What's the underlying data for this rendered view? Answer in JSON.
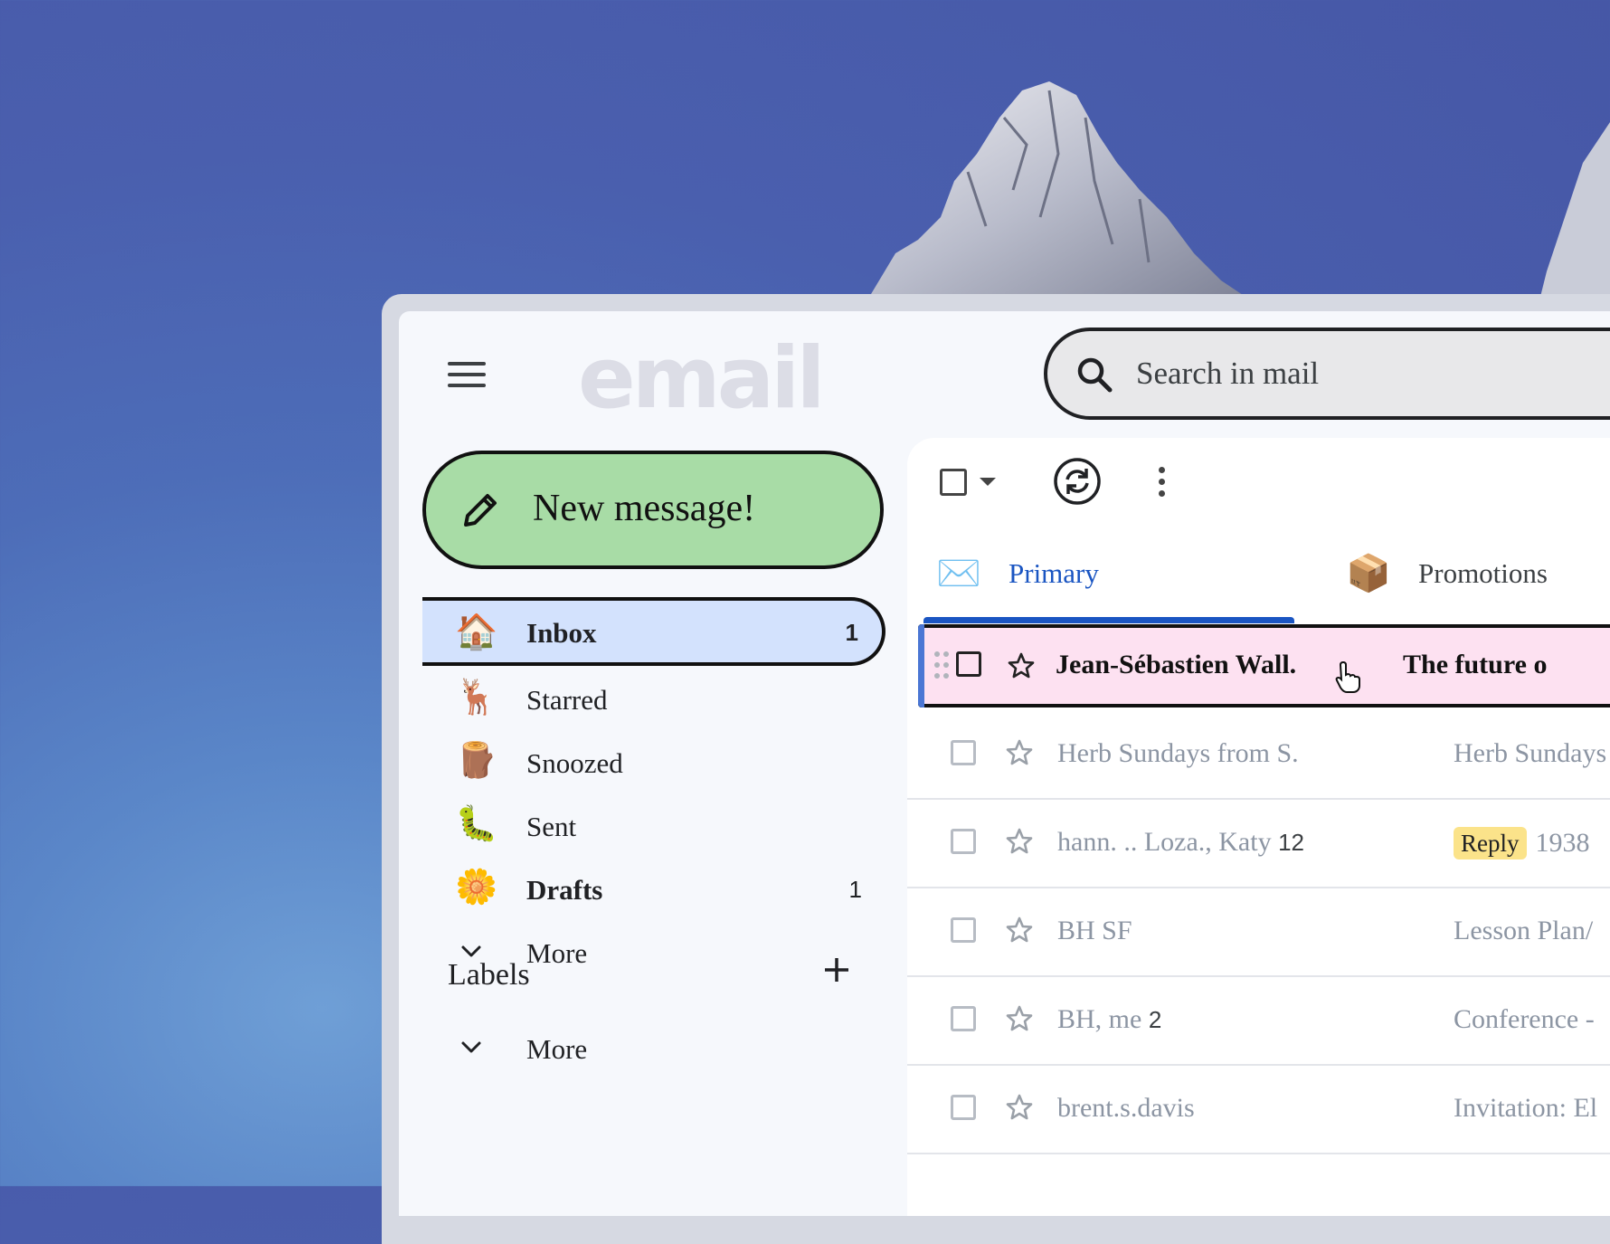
{
  "app": {
    "logo": "email",
    "search_placeholder": "Search in mail"
  },
  "compose": {
    "label": "New message!"
  },
  "nav": [
    {
      "label": "Inbox",
      "emoji": "🏠",
      "count": "1",
      "active": true
    },
    {
      "label": "Starred",
      "emoji": "🦌",
      "count": ""
    },
    {
      "label": "Snoozed",
      "emoji": "🪵",
      "count": ""
    },
    {
      "label": "Sent",
      "emoji": "🐛",
      "count": ""
    },
    {
      "label": "Drafts",
      "emoji": "🌼",
      "count": "1"
    },
    {
      "label": "More",
      "icon": "chevron-down-icon"
    }
  ],
  "labels": {
    "heading": "Labels",
    "more": "More"
  },
  "tabs": [
    {
      "label": "Primary",
      "emoji": "✉️",
      "active": true
    },
    {
      "label": "Promotions",
      "emoji": "📦"
    }
  ],
  "emails": [
    {
      "sender": "Jean-Sébastien Wall.",
      "count": "",
      "subject": "The future o",
      "selected": true
    },
    {
      "sender": "Herb Sundays from S.",
      "count": "",
      "subject": "Herb Sundays"
    },
    {
      "sender": "hann. .. Loza., Katy",
      "count": "12",
      "badge": "Reply",
      "subject": "1938"
    },
    {
      "sender": "BH SF",
      "count": "",
      "subject": "Lesson Plan/"
    },
    {
      "sender": "BH, me",
      "count": "2",
      "subject": "Conference -"
    },
    {
      "sender": "brent.s.davis",
      "count": "",
      "subject": "Invitation: El"
    }
  ],
  "colors": {
    "compose_bg": "#a8dca6",
    "inbox_active_bg": "#d3e2fd",
    "selected_row_bg": "#fde1f1",
    "tab_accent": "#1a55c2",
    "reply_badge": "#fbe38a"
  }
}
